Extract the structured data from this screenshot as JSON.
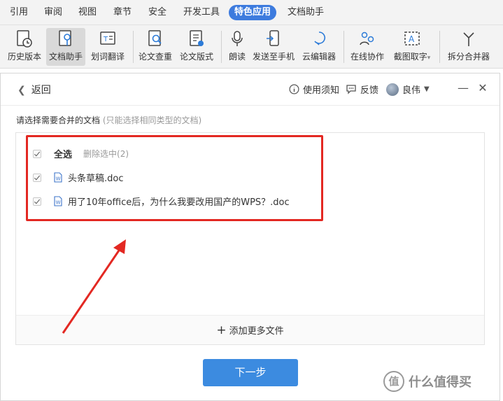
{
  "menu": {
    "tabs": [
      "引用",
      "审阅",
      "视图",
      "章节",
      "安全",
      "开发工具",
      "特色应用",
      "文档助手"
    ],
    "active": "特色应用"
  },
  "ribbon": {
    "buttons": [
      {
        "label": "历史版本",
        "icon": "history-icon"
      },
      {
        "label": "文档助手",
        "icon": "doc-assistant-icon"
      },
      {
        "label": "划词翻译",
        "icon": "translate-icon"
      },
      {
        "label": "论文查重",
        "icon": "plagiarism-check-icon"
      },
      {
        "label": "论文版式",
        "icon": "paper-format-icon"
      },
      {
        "label": "朗读",
        "icon": "microphone-icon"
      },
      {
        "label": "发送至手机",
        "icon": "send-to-phone-icon"
      },
      {
        "label": "云编辑器",
        "icon": "cloud-editor-icon"
      },
      {
        "label": "在线协作",
        "icon": "collaborate-icon"
      },
      {
        "label": "截图取字",
        "icon": "ocr-icon"
      },
      {
        "label": "拆分合并器",
        "icon": "split-merge-icon"
      }
    ],
    "selected": "文档助手",
    "dropdown_suffix": "▾"
  },
  "dialog": {
    "back_label": "返回",
    "notice_label": "使用须知",
    "feedback_label": "反馈",
    "user_name": "良伟",
    "instruction": "请选择需要合并的文档",
    "instruction_hint": "(只能选择相同类型的文档)",
    "select_all": "全选",
    "delete_selected": "删除选中(2)",
    "files": [
      {
        "name": "头条草稿.doc",
        "checked": true
      },
      {
        "name": "用了10年office后，为什么我要改用国产的WPS？.doc",
        "checked": true
      }
    ],
    "add_more": "添加更多文件",
    "next_button": "下一步"
  },
  "watermark": {
    "logo": "值",
    "text": "什么值得买"
  },
  "colors": {
    "accent": "#3c8be0",
    "active_tab": "#3d7bde",
    "highlight": "#e32822"
  }
}
